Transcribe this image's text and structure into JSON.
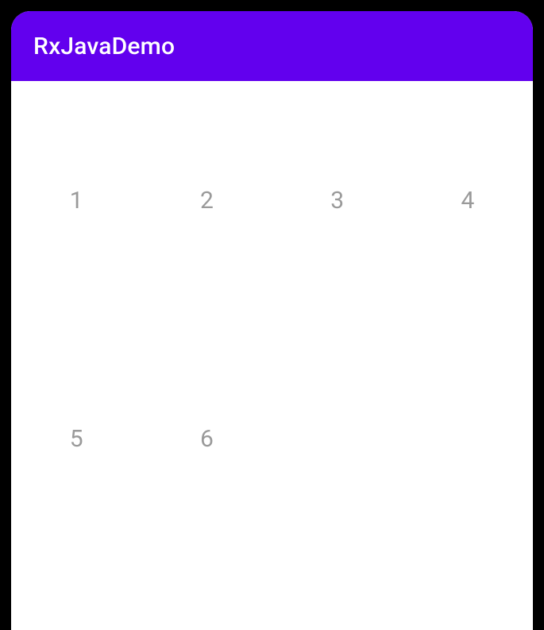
{
  "appBar": {
    "title": "RxJavaDemo"
  },
  "grid": {
    "items": [
      {
        "label": "1"
      },
      {
        "label": "2"
      },
      {
        "label": "3"
      },
      {
        "label": "4"
      },
      {
        "label": "5"
      },
      {
        "label": "6"
      }
    ]
  }
}
